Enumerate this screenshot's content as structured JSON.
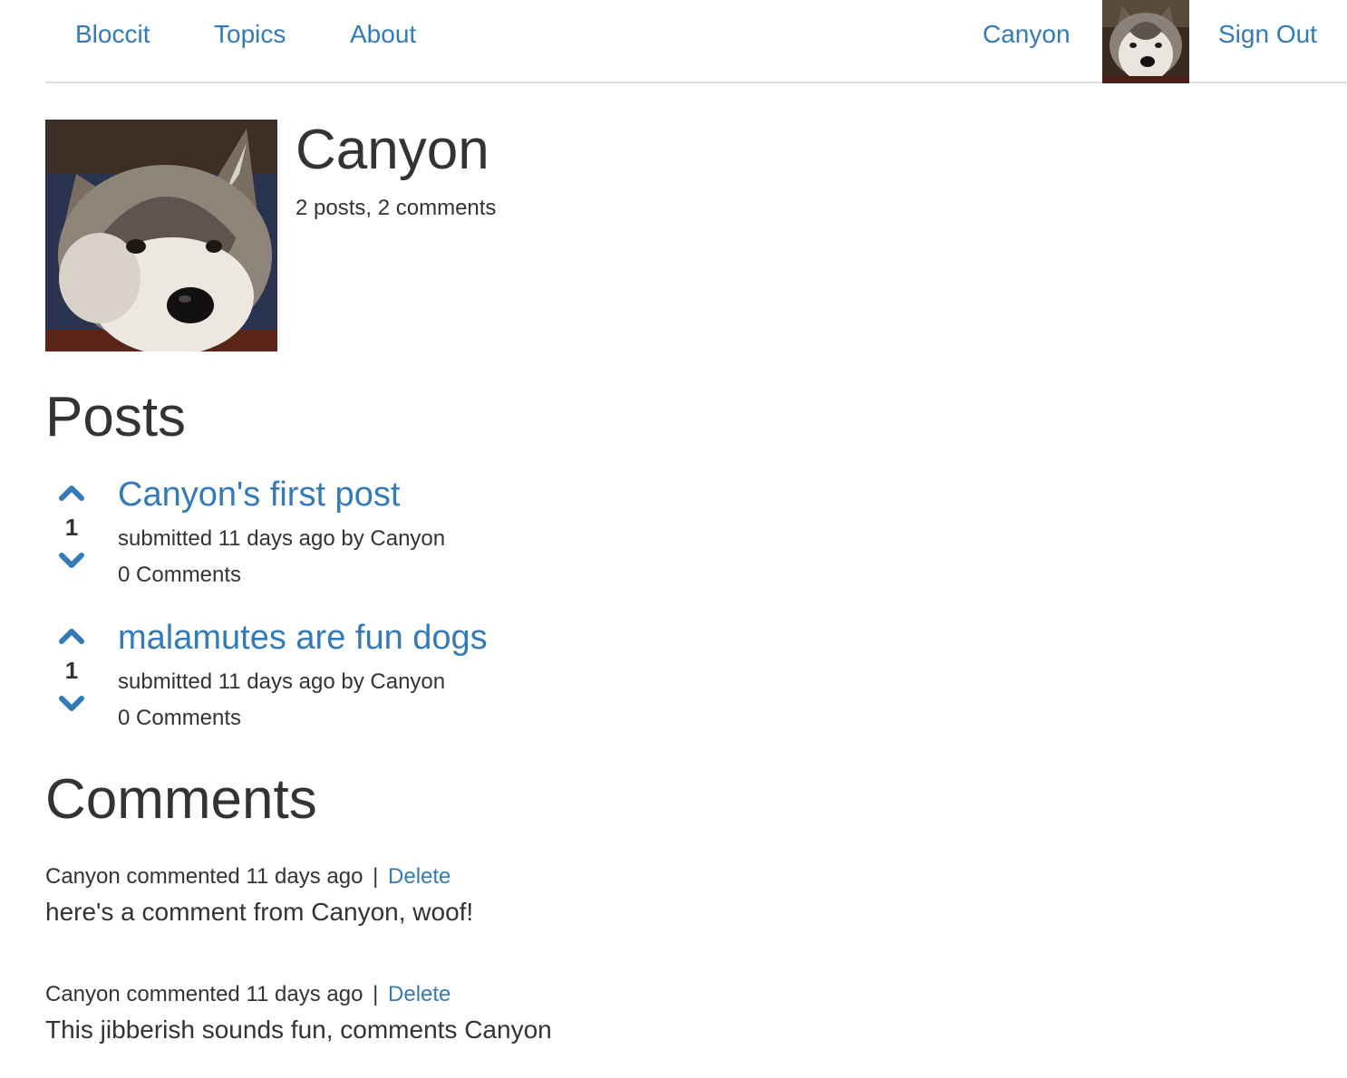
{
  "navbar": {
    "brand": "Bloccit",
    "topics": "Topics",
    "about": "About",
    "username": "Canyon",
    "avatar_icon": "user-avatar-dog-photo",
    "sign_out": "Sign Out"
  },
  "profile": {
    "name": "Canyon",
    "stats": "2 posts, 2 comments",
    "avatar_icon": "profile-avatar-dog-photo"
  },
  "posts_section": {
    "title": "Posts",
    "items": [
      {
        "title": "Canyon's first post",
        "votes": "1",
        "meta": "submitted 11 days ago by Canyon",
        "comments": "0 Comments"
      },
      {
        "title": "malamutes are fun dogs",
        "votes": "1",
        "meta": "submitted 11 days ago by Canyon",
        "comments": "0 Comments"
      }
    ]
  },
  "comments_section": {
    "title": "Comments",
    "items": [
      {
        "meta": "Canyon commented 11 days ago",
        "separator": "|",
        "delete": "Delete",
        "body": "here's a comment from Canyon, woof!"
      },
      {
        "meta": "Canyon commented 11 days ago",
        "separator": "|",
        "delete": "Delete",
        "body": "This jibberish sounds fun, comments Canyon"
      }
    ]
  },
  "colors": {
    "link": "#337ab7",
    "text": "#333333",
    "divider": "#dddddd"
  }
}
